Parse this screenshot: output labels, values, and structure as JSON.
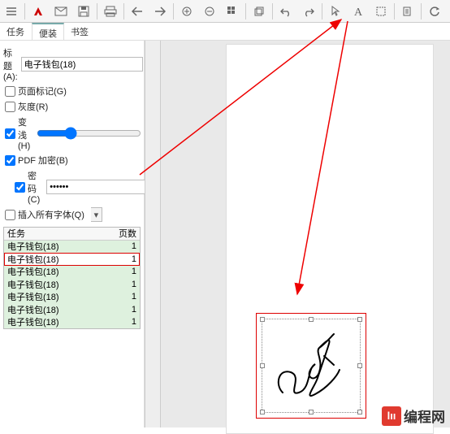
{
  "toolbar": {
    "icons": [
      "menu-icon",
      "adobe-icon",
      "mail-icon",
      "save-icon",
      "print-icon",
      "back-icon",
      "forward-icon",
      "zoom-in-icon",
      "zoom-out-icon",
      "grid-icon",
      "layers-icon",
      "undo-icon",
      "redo-icon",
      "pointer-icon",
      "text-tool-icon",
      "crop-tool-icon",
      "copy-icon",
      "reload-icon"
    ]
  },
  "tabs": {
    "items": [
      "任务",
      "便装",
      "书签"
    ],
    "active_index": 1
  },
  "panel": {
    "title_label": "标题(A):",
    "title_value": "电子钱包(18)",
    "page_marks_label": "页面标记(G)",
    "gray_label": "灰度(R)",
    "fade_label": "变浅(H)",
    "fade_checked": true,
    "pdf_encrypt_label": "PDF 加密(B)",
    "pdf_encrypt_checked": true,
    "password_label": "密码(C)",
    "password_checked": true,
    "password_value": "••••••",
    "insert_fonts_label": "插入所有字体(Q)"
  },
  "task_table": {
    "headers": {
      "name": "任务",
      "pages": "页数"
    },
    "rows": [
      {
        "name": "电子钱包(18)",
        "pages": "1",
        "selected": false,
        "alt": true
      },
      {
        "name": "电子钱包(18)",
        "pages": "1",
        "selected": true,
        "alt": false
      },
      {
        "name": "电子钱包(18)",
        "pages": "1",
        "selected": false,
        "alt": true
      },
      {
        "name": "电子钱包(18)",
        "pages": "1",
        "selected": false,
        "alt": true
      },
      {
        "name": "电子钱包(18)",
        "pages": "1",
        "selected": false,
        "alt": true
      },
      {
        "name": "电子钱包(18)",
        "pages": "1",
        "selected": false,
        "alt": true
      },
      {
        "name": "电子钱包(18)",
        "pages": "1",
        "selected": false,
        "alt": true
      }
    ]
  },
  "logo_text": "编程网"
}
